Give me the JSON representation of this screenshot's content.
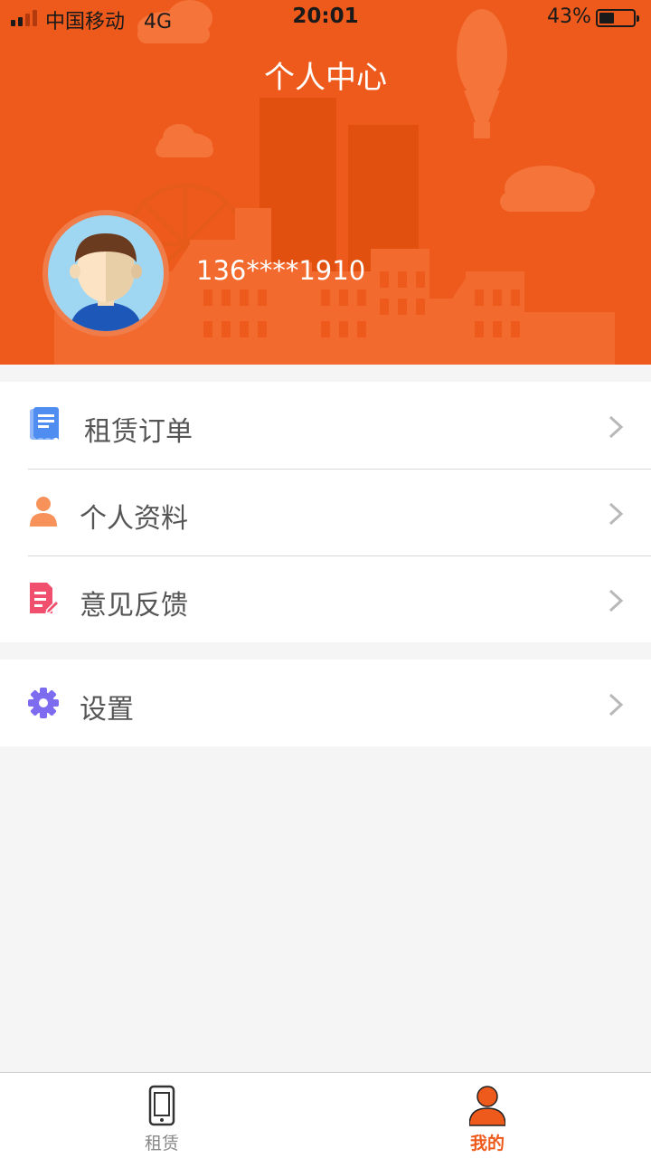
{
  "status_bar": {
    "carrier": "中国移动",
    "network": "4G",
    "time": "20:01",
    "battery_percent": "43%",
    "battery_level": 0.43
  },
  "header": {
    "title": "个人中心",
    "phone": "136****1910",
    "avatar_icon": "user-avatar-icon",
    "accent_color": "#ee5a1c"
  },
  "menu": {
    "group1": [
      {
        "label": "租赁订单",
        "icon": "receipt-icon",
        "icon_color": "#4f8ef0"
      },
      {
        "label": "个人资料",
        "icon": "person-icon",
        "icon_color": "#f7925a"
      },
      {
        "label": "意见反馈",
        "icon": "feedback-edit-icon",
        "icon_color": "#f0506e"
      }
    ],
    "group2": [
      {
        "label": "设置",
        "icon": "gear-icon",
        "icon_color": "#7e6cf0"
      }
    ]
  },
  "tabbar": {
    "tabs": [
      {
        "label": "租赁",
        "icon": "phone-icon",
        "active": false
      },
      {
        "label": "我的",
        "icon": "person-icon",
        "active": true
      }
    ]
  }
}
